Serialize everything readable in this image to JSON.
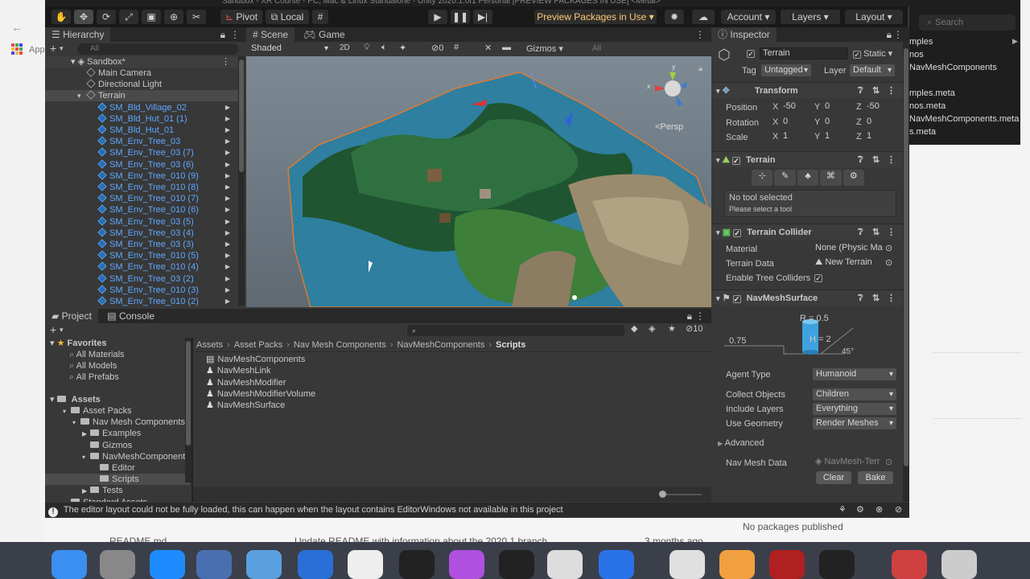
{
  "window": {
    "title_fragment": "Sandbox - XR Course - PC, Mac & Linux Standalone - Unity 2020.1.0f1 Personal [PREVIEW PACKAGES IN USE] <Metal>"
  },
  "toolbar": {
    "pivot": "Pivot",
    "local": "Local",
    "preview_packages": "Preview Packages in Use",
    "account": "Account",
    "layers": "Layers",
    "layout": "Layout"
  },
  "hierarchy": {
    "tab": "Hierarchy",
    "search_placeholder": "All",
    "scene": "Sandbox*",
    "items": [
      {
        "label": "Main Camera",
        "indent": 1,
        "blue": false
      },
      {
        "label": "Directional Light",
        "indent": 1,
        "blue": false
      },
      {
        "label": "Terrain",
        "indent": 1,
        "blue": false
      },
      {
        "label": "SM_Bld_Village_02",
        "indent": 2,
        "blue": true
      },
      {
        "label": "SM_Bld_Hut_01 (1)",
        "indent": 2,
        "blue": true
      },
      {
        "label": "SM_Bld_Hut_01",
        "indent": 2,
        "blue": true
      },
      {
        "label": "SM_Env_Tree_03",
        "indent": 2,
        "blue": true
      },
      {
        "label": "SM_Env_Tree_03 (7)",
        "indent": 2,
        "blue": true
      },
      {
        "label": "SM_Env_Tree_03 (6)",
        "indent": 2,
        "blue": true
      },
      {
        "label": "SM_Env_Tree_010 (9)",
        "indent": 2,
        "blue": true
      },
      {
        "label": "SM_Env_Tree_010 (8)",
        "indent": 2,
        "blue": true
      },
      {
        "label": "SM_Env_Tree_010 (7)",
        "indent": 2,
        "blue": true
      },
      {
        "label": "SM_Env_Tree_010 (6)",
        "indent": 2,
        "blue": true
      },
      {
        "label": "SM_Env_Tree_03 (5)",
        "indent": 2,
        "blue": true
      },
      {
        "label": "SM_Env_Tree_03 (4)",
        "indent": 2,
        "blue": true
      },
      {
        "label": "SM_Env_Tree_03 (3)",
        "indent": 2,
        "blue": true
      },
      {
        "label": "SM_Env_Tree_010 (5)",
        "indent": 2,
        "blue": true
      },
      {
        "label": "SM_Env_Tree_010 (4)",
        "indent": 2,
        "blue": true
      },
      {
        "label": "SM_Env_Tree_03 (2)",
        "indent": 2,
        "blue": true
      },
      {
        "label": "SM_Env_Tree_010 (3)",
        "indent": 2,
        "blue": true
      },
      {
        "label": "SM_Env_Tree_010 (2)",
        "indent": 2,
        "blue": true
      }
    ]
  },
  "scene_view": {
    "tab_scene": "Scene",
    "tab_game": "Game",
    "shading": "Shaded",
    "mode_2d": "2D",
    "gizmos": "Gizmos",
    "search_placeholder": "All",
    "fx_count": "0",
    "persp": "<Persp"
  },
  "project": {
    "tab_project": "Project",
    "tab_console": "Console",
    "badge_count": "10",
    "favorites_label": "Favorites",
    "favorites": [
      "All Materials",
      "All Models",
      "All Prefabs"
    ],
    "assets_label": "Assets",
    "tree": [
      {
        "label": "Asset Packs",
        "indent": 1
      },
      {
        "label": "Nav Mesh Components",
        "indent": 2
      },
      {
        "label": "Examples",
        "indent": 3
      },
      {
        "label": "Gizmos",
        "indent": 3
      },
      {
        "label": "NavMeshComponent",
        "indent": 3
      },
      {
        "label": "Editor",
        "indent": 4
      },
      {
        "label": "Scripts",
        "indent": 4
      },
      {
        "label": "Tests",
        "indent": 3
      },
      {
        "label": "Standard Assets",
        "indent": 1
      }
    ],
    "breadcrumb": [
      "Assets",
      "Asset Packs",
      "Nav Mesh Components",
      "NavMeshComponents",
      "Scripts"
    ],
    "files": [
      "NavMeshComponents",
      "NavMeshLink",
      "NavMeshModifier",
      "NavMeshModifierVolume",
      "NavMeshSurface"
    ]
  },
  "inspector": {
    "tab": "Inspector",
    "object_name": "Terrain",
    "static_label": "Static",
    "tag_label": "Tag",
    "tag_value": "Untagged",
    "layer_label": "Layer",
    "layer_value": "Default",
    "transform": {
      "title": "Transform",
      "position_label": "Position",
      "rotation_label": "Rotation",
      "scale_label": "Scale",
      "position": [
        "-50",
        "0",
        "-50"
      ],
      "rotation": [
        "0",
        "0",
        "0"
      ],
      "scale": [
        "1",
        "1",
        "1"
      ]
    },
    "terrain": {
      "title": "Terrain",
      "no_tool": "No tool selected",
      "please_select": "Please select a tool"
    },
    "collider": {
      "title": "Terrain Collider",
      "material_label": "Material",
      "material_value": "None (Physic Ma",
      "data_label": "Terrain Data",
      "data_value": "New Terrain",
      "trees_label": "Enable Tree Colliders"
    },
    "navmesh": {
      "title": "NavMeshSurface",
      "r_label": "R = 0.5",
      "h_label": "H = 2",
      "step_label": "0.75",
      "slope_label": "45°",
      "agent_label": "Agent Type",
      "agent_value": "Humanoid",
      "collect_label": "Collect Objects",
      "collect_value": "Children",
      "layers_label": "Include Layers",
      "layers_value": "Everything",
      "geometry_label": "Use Geometry",
      "geometry_value": "Render Meshes",
      "advanced_label": "Advanced",
      "data_label": "Nav Mesh Data",
      "data_value": "NavMesh-Terr",
      "clear": "Clear",
      "bake": "Bake"
    }
  },
  "status_bar": {
    "message": "The editor layout could not be fully loaded, this can happen when the layout contains EditorWindows not available in this project"
  },
  "background": {
    "right_files": [
      "mples",
      "nos",
      "NavMeshComponents",
      "mples.meta",
      "nos.meta",
      "NavMeshComponents.meta",
      "s.meta"
    ],
    "search_placeholder": "Search",
    "readme": "README.md",
    "commit": "Update README with information about the 2020.1 branch",
    "time": "3 months ago",
    "no_packages": "No packages published",
    "apps_label": "App"
  },
  "colors": {
    "accent_blue": "#5ea8ff",
    "preview_orange": "#ff8c00",
    "toolbar_bg": "#191919",
    "panel_bg": "#383838"
  },
  "dock": {
    "icons": [
      "finder-icon",
      "system-preferences-icon",
      "xcode-icon",
      "instruments-icon",
      "simulator-icon",
      "safari-icon",
      "textedit-icon",
      "terminal-icon",
      "podcasts-icon",
      "apple-tv-icon",
      "unity-icon",
      "signal-icon",
      "chrome-icon",
      "photos-icon",
      "filezilla-icon",
      "unity-hub-icon",
      "downloads-icon",
      "trash-icon"
    ]
  }
}
